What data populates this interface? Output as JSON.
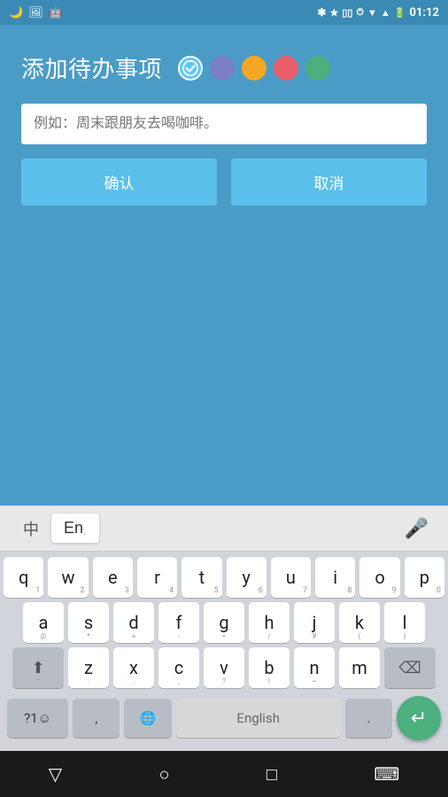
{
  "statusBar": {
    "time": "01:12",
    "icons": [
      "🌙",
      "🖼",
      "🤖"
    ]
  },
  "dialog": {
    "title": "添加待办事项",
    "input_placeholder": "例如：周末跟朋友去喝咖啡。",
    "confirm_label": "确认",
    "cancel_label": "取消",
    "colors": [
      {
        "id": "checked",
        "label": "checked"
      },
      {
        "id": "blue",
        "label": "blue"
      },
      {
        "id": "yellow",
        "label": "yellow"
      },
      {
        "id": "red",
        "label": "red"
      },
      {
        "id": "green",
        "label": "green"
      }
    ]
  },
  "keyboard": {
    "lang_chinese": "中",
    "lang_english": "En",
    "rows": [
      [
        "q",
        "w",
        "e",
        "r",
        "t",
        "y",
        "u",
        "i",
        "o",
        "p"
      ],
      [
        "a",
        "s",
        "d",
        "f",
        "g",
        "h",
        "j",
        "k",
        "l"
      ],
      [
        "z",
        "x",
        "c",
        "v",
        "b",
        "n",
        "m"
      ]
    ],
    "nums": [
      "1",
      "2",
      "3",
      "4",
      "5",
      "6",
      "7",
      "8",
      "9",
      "0"
    ],
    "row2nums": [
      "@",
      "*",
      "+",
      "-",
      "=",
      "/",
      "#",
      "(",
      ")"
    ],
    "row3syms": [
      ":",
      ".",
      ",",
      "?",
      "!",
      "~",
      ""
    ],
    "symbols_label": "?1☺",
    "comma_label": ",",
    "globe_label": "🌐",
    "space_label": "English",
    "period_label": ".",
    "enter_label": "↵"
  },
  "navbar": {
    "back_label": "▽",
    "home_label": "○",
    "recent_label": "□",
    "keyboard_label": "⌨"
  }
}
